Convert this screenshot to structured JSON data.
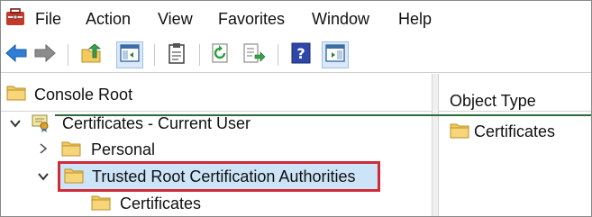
{
  "menu": {
    "items": [
      "File",
      "Action",
      "View",
      "Favorites",
      "Window",
      "Help"
    ]
  },
  "toolbar": {
    "buttons": [
      {
        "name": "back-icon"
      },
      {
        "name": "forward-icon"
      },
      {
        "name": "up-folder-icon"
      },
      {
        "name": "show-hide-console-tree-icon"
      },
      {
        "name": "clipboard-icon"
      },
      {
        "name": "refresh-icon"
      },
      {
        "name": "export-list-icon"
      },
      {
        "name": "help-icon"
      },
      {
        "name": "show-hide-action-pane-icon"
      }
    ]
  },
  "tree": {
    "root_label": "Console Root",
    "items": [
      {
        "label": "Certificates - Current User",
        "expanded": true
      },
      {
        "label": "Personal",
        "expanded": false
      },
      {
        "label": "Trusted Root Certification Authorities",
        "expanded": true,
        "selected": true
      },
      {
        "label": "Certificates"
      }
    ]
  },
  "details": {
    "column_header": "Object Type",
    "rows": [
      "Certificates"
    ]
  },
  "colors": {
    "selection_border": "#d12b3a",
    "selection_fill": "#cce4f7",
    "folder_yellow": "#f4c95d",
    "accent_line": "#2e6b3a"
  }
}
